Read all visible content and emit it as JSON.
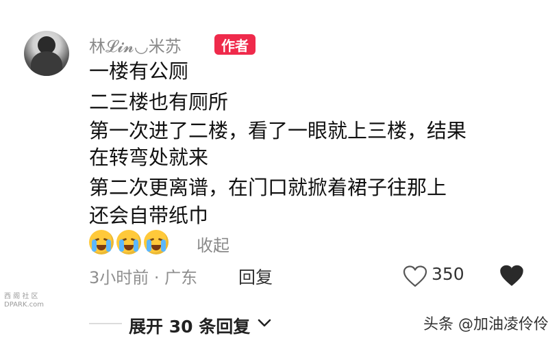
{
  "comment": {
    "username": "林𝓛𝓲𝓷◡米苏",
    "author_badge": "作者",
    "lines": [
      "一楼有公厕",
      " 二三楼也有厕所",
      " 第一次进了二楼，看了一眼就上三楼，结果",
      "在转弯处就来",
      " 第二次更离谱，在门口就掀着裙子往那上",
      " 还会自带纸巾"
    ],
    "emojis": [
      "crying-face-icon",
      "crying-face-icon",
      "crying-face-icon"
    ],
    "collapse_label": "收起",
    "meta": "3小时前 · 广东",
    "reply_label": "回复",
    "like_count": "350",
    "expand_label": "展开 30 条回复"
  },
  "watermarks": {
    "left_top": "西 阁 社 区",
    "left_bottom": "DPARK.com",
    "right": "头条 @加油凌伶伶"
  }
}
